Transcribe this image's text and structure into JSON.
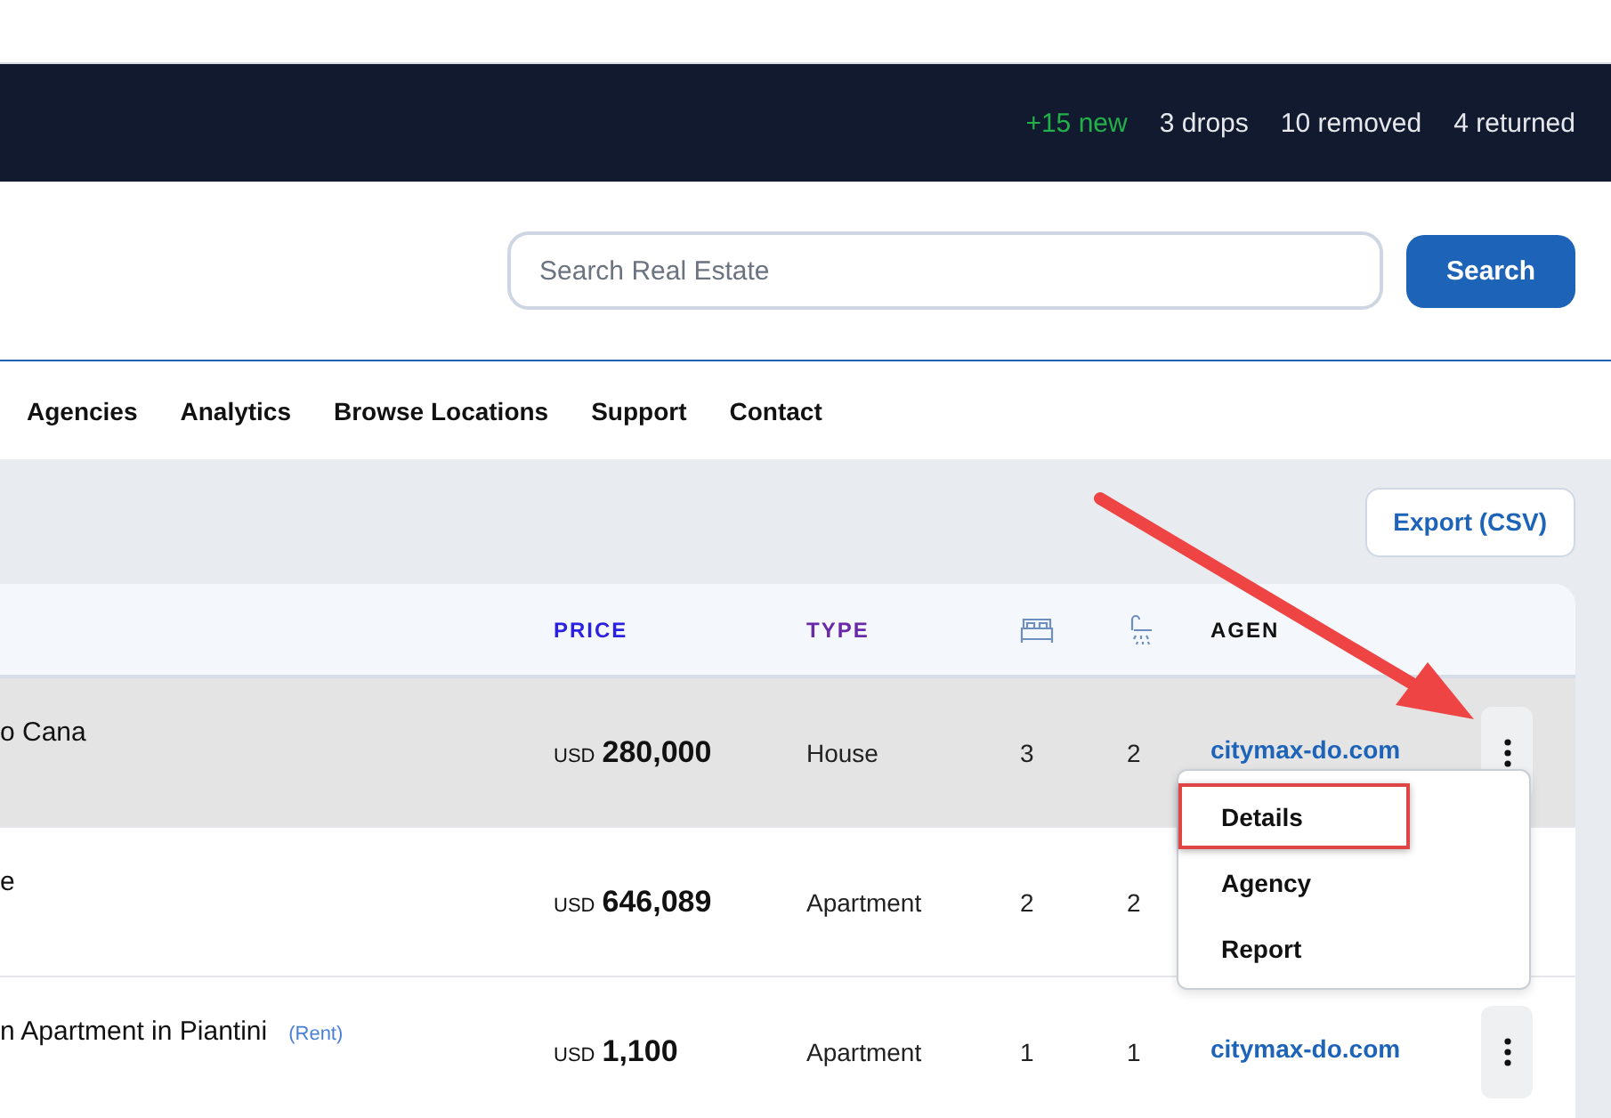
{
  "stats": [
    {
      "text": "+15 new",
      "kind": "new"
    },
    {
      "text": "3 drops",
      "kind": "plain"
    },
    {
      "text": "10 removed",
      "kind": "plain"
    },
    {
      "text": "4 returned",
      "kind": "plain"
    }
  ],
  "search": {
    "placeholder": "Search Real Estate",
    "button": "Search"
  },
  "nav": [
    "Agencies",
    "Analytics",
    "Browse Locations",
    "Support",
    "Contact"
  ],
  "export_button": "Export (CSV)",
  "table": {
    "columns": [
      {
        "label": "PRICE",
        "kind": "price"
      },
      {
        "label": "TYPE",
        "kind": "type"
      },
      {
        "kind": "beds"
      },
      {
        "kind": "baths"
      },
      {
        "label": "AGEN",
        "kind": "agency"
      }
    ],
    "rows": [
      {
        "title": "o Cana",
        "currency": "USD",
        "price": "280,000",
        "type": "House",
        "beds": "3",
        "baths": "2",
        "agency": "citymax-do.com",
        "selected": true,
        "menu_button": true
      },
      {
        "title": "e",
        "currency": "USD",
        "price": "646,089",
        "type": "Apartment",
        "beds": "2",
        "baths": "2",
        "selected": false,
        "menu_button": false
      },
      {
        "title": "n Apartment in Piantini",
        "tag": "(Rent)",
        "currency": "USD",
        "price": "1,100",
        "type": "Apartment",
        "beds": "1",
        "baths": "1",
        "agency": "citymax-do.com",
        "selected": false,
        "menu_button": true
      }
    ]
  },
  "menu": {
    "items": [
      {
        "label": "Details",
        "annotated": true
      },
      {
        "label": "Agency",
        "annotated": false
      },
      {
        "label": "Report",
        "annotated": false
      }
    ]
  }
}
